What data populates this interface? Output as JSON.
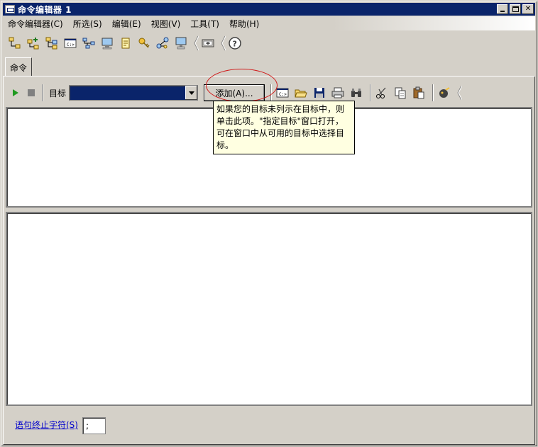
{
  "window": {
    "title": "命令编辑器 1"
  },
  "menubar": {
    "items": [
      "命令编辑器(C)",
      "所选(S)",
      "编辑(E)",
      "视图(V)",
      "工具(T)",
      "帮助(H)"
    ]
  },
  "main_toolbar": {
    "icons": [
      "tree-icon",
      "add-tree-icon",
      "tree-alt-icon",
      "command-window-icon",
      "connect-icon",
      "monitor-icon",
      "notes-icon",
      "key-icon",
      "network-icon",
      "computer-icon",
      "panel-icon",
      "help-icon"
    ]
  },
  "tab": {
    "label": "命令"
  },
  "command_toolbar": {
    "target_label": "目标",
    "target_value": "",
    "add_button": "添加(A)...",
    "icons": [
      "command-window-icon",
      "open-folder-icon",
      "save-icon",
      "print-icon",
      "find-icon",
      "cut-icon",
      "copy-icon",
      "paste-icon",
      "clear-icon"
    ]
  },
  "tooltip": {
    "lines": [
      "如果您的目标未列示在目标中，则",
      "单击此项。\"指定目标\"窗口打开，",
      "可在窗口中从可用的目标中选择目",
      "标。"
    ]
  },
  "footer": {
    "terminator_label": "语句终止字符(S)",
    "terminator_value": ";"
  },
  "colors": {
    "titlebar": "#0a246a",
    "face": "#d4d0c8",
    "tooltip_bg": "#ffffe1",
    "highlight_circle": "#d01818",
    "link": "#0000cc"
  }
}
